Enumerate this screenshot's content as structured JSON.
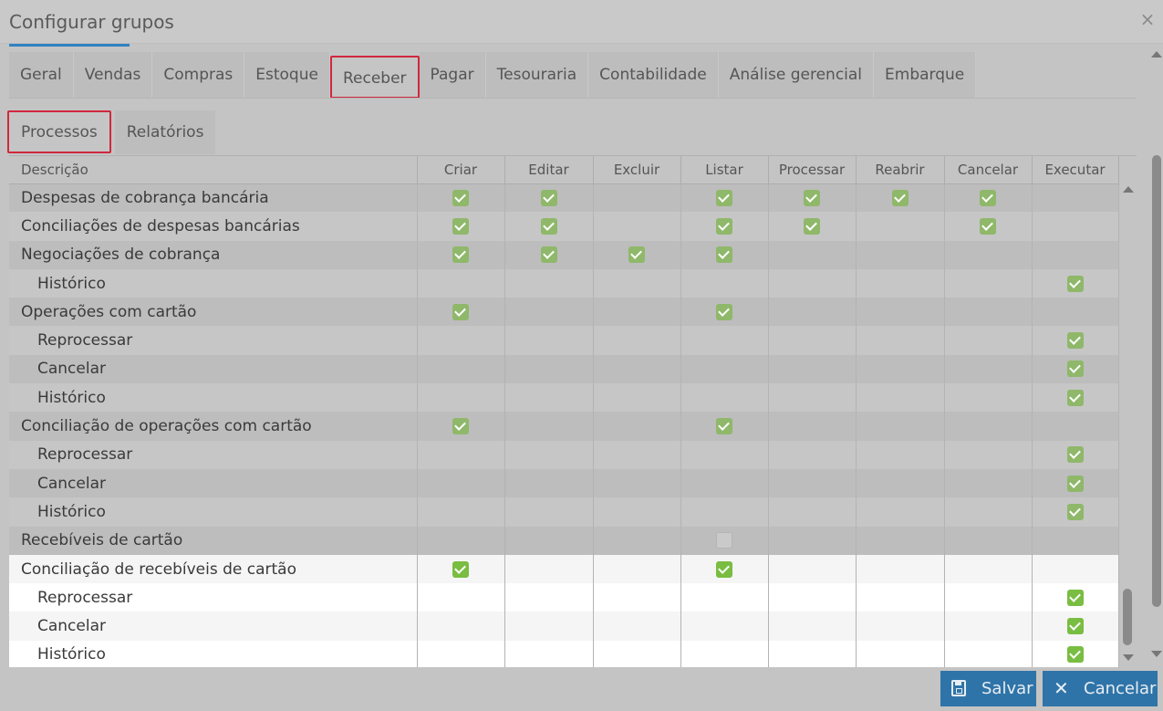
{
  "dialog": {
    "title": "Configurar grupos",
    "close_icon": "×"
  },
  "main_tabs": [
    "Geral",
    "Vendas",
    "Compras",
    "Estoque",
    "Receber",
    "Pagar",
    "Tesouraria",
    "Contabilidade",
    "Análise gerencial",
    "Embarque"
  ],
  "main_tabs_active": "Receber",
  "sub_tabs": [
    "Processos",
    "Relatórios"
  ],
  "sub_tabs_active": "Processos",
  "table": {
    "columns": [
      "Descrição",
      "Criar",
      "Editar",
      "Excluir",
      "Listar",
      "Processar",
      "Reabrir",
      "Cancelar",
      "Executar"
    ],
    "rows": [
      {
        "label": "Despesas de cobrança bancária",
        "indent": false,
        "cells": [
          1,
          1,
          0,
          1,
          1,
          1,
          1,
          0
        ]
      },
      {
        "label": "Conciliações de despesas bancárias",
        "indent": false,
        "cells": [
          1,
          1,
          0,
          1,
          1,
          0,
          1,
          0
        ]
      },
      {
        "label": "Negociações de cobrança",
        "indent": false,
        "cells": [
          1,
          1,
          1,
          1,
          0,
          0,
          0,
          0
        ]
      },
      {
        "label": "Histórico",
        "indent": true,
        "cells": [
          0,
          0,
          0,
          0,
          0,
          0,
          0,
          1
        ]
      },
      {
        "label": "Operações com cartão",
        "indent": false,
        "cells": [
          1,
          0,
          0,
          1,
          0,
          0,
          0,
          0
        ]
      },
      {
        "label": "Reprocessar",
        "indent": true,
        "cells": [
          0,
          0,
          0,
          0,
          0,
          0,
          0,
          1
        ]
      },
      {
        "label": "Cancelar",
        "indent": true,
        "cells": [
          0,
          0,
          0,
          0,
          0,
          0,
          0,
          1
        ]
      },
      {
        "label": "Histórico",
        "indent": true,
        "cells": [
          0,
          0,
          0,
          0,
          0,
          0,
          0,
          1
        ]
      },
      {
        "label": "Conciliação de operações com cartão",
        "indent": false,
        "cells": [
          1,
          0,
          0,
          1,
          0,
          0,
          0,
          0
        ]
      },
      {
        "label": "Reprocessar",
        "indent": true,
        "cells": [
          0,
          0,
          0,
          0,
          0,
          0,
          0,
          1
        ]
      },
      {
        "label": "Cancelar",
        "indent": true,
        "cells": [
          0,
          0,
          0,
          0,
          0,
          0,
          0,
          1
        ]
      },
      {
        "label": "Histórico",
        "indent": true,
        "cells": [
          0,
          0,
          0,
          0,
          0,
          0,
          0,
          1
        ]
      },
      {
        "label": "Recebíveis de cartão",
        "indent": false,
        "cells": [
          0,
          0,
          0,
          2,
          0,
          0,
          0,
          0
        ]
      },
      {
        "label": "Conciliação de recebíveis de cartão",
        "indent": false,
        "highlight": true,
        "cells": [
          1,
          0,
          0,
          1,
          0,
          0,
          0,
          0
        ]
      },
      {
        "label": "Reprocessar",
        "indent": true,
        "highlight": true,
        "cells": [
          0,
          0,
          0,
          0,
          0,
          0,
          0,
          1
        ]
      },
      {
        "label": "Cancelar",
        "indent": true,
        "highlight": true,
        "cells": [
          0,
          0,
          0,
          0,
          0,
          0,
          0,
          1
        ]
      },
      {
        "label": "Histórico",
        "indent": true,
        "highlight": true,
        "cells": [
          0,
          0,
          0,
          0,
          0,
          0,
          0,
          1
        ]
      }
    ]
  },
  "footer": {
    "save_label": "Salvar",
    "cancel_label": "Cancelar"
  },
  "colors": {
    "accent": "#2f74a8",
    "active_tab_border": "#d0283d",
    "check": "#8fb86a"
  }
}
